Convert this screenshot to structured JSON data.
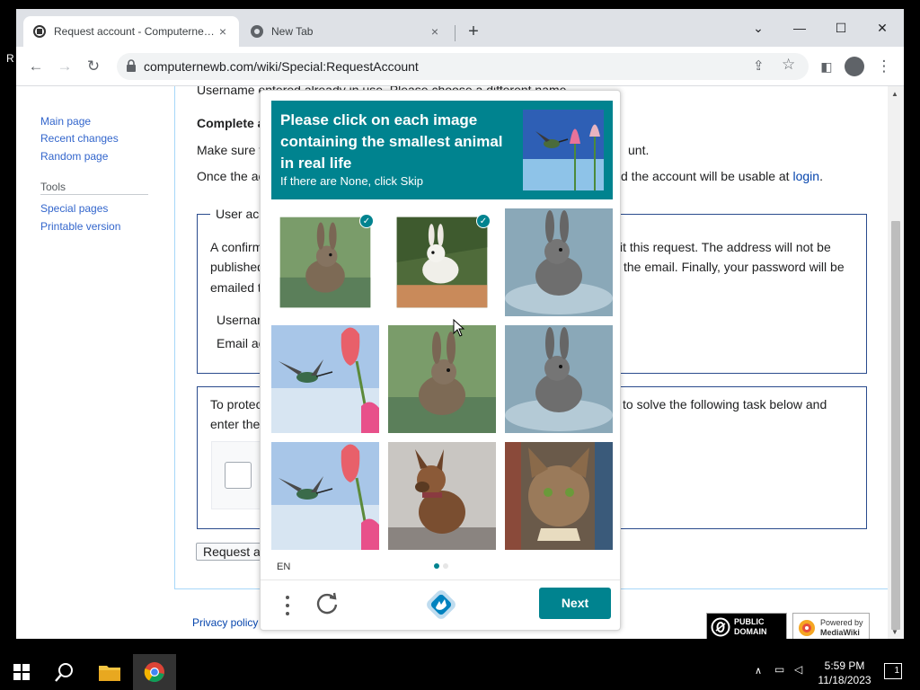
{
  "desktop": {
    "edge_letter": "R"
  },
  "browser": {
    "tabs": [
      {
        "title": "Request account - Computernewb",
        "close": "×"
      },
      {
        "title": "New Tab",
        "close": "×"
      }
    ],
    "new_tab": "+",
    "window_controls": {
      "menu": "⌄",
      "minimize": "—",
      "maximize": "☐",
      "close": "✕"
    },
    "toolbar": {
      "back": "←",
      "forward": "→",
      "reload": "↻",
      "url": "computernewb.com/wiki/Special:RequestAccount",
      "menu": "⋮"
    }
  },
  "wiki": {
    "sidebar": {
      "nav": [
        "Main page",
        "Recent changes",
        "Random page"
      ],
      "tools_heading": "Tools",
      "tools": [
        "Special pages",
        "Printable version"
      ]
    },
    "content": {
      "error_line": "Username entered already in use. Please choose a different name.",
      "complete_heading": "Complete a",
      "make_sure_left": "Make sure t",
      "make_sure_right": "unt.",
      "once_left": "Once the ac",
      "once_right": "d the account will be usable at",
      "login_link": "login",
      "login_period": ".",
      "fieldset_legend": "User ac",
      "confirm_l1_left": "A confirm",
      "confirm_l1_right": "it this request. The address will not be",
      "confirm_l2_left": "published",
      "confirm_l2_right": "the email. Finally, your password will be",
      "confirm_l3_left": "emailed t",
      "username_label": "Usernar",
      "email_label": "Email ac",
      "protect_l1_left": "To protec",
      "protect_l1_right": "to solve the following task below and",
      "protect_l2_left": "enter the",
      "request_button": "Request ac"
    },
    "footer": {
      "privacy": "Privacy policy",
      "badge_pd": "PUBLIC DOMAIN",
      "badge_mw_1": "Powered by",
      "badge_mw_2": "MediaWiki"
    }
  },
  "captcha": {
    "prompt": "Please click on each image containing the smallest animal in real life",
    "sub": "If there are None, click Skip",
    "example_icon": "hummingbird-flower-example",
    "grid": [
      {
        "subject": "rabbit",
        "selected": true
      },
      {
        "subject": "white-rabbit",
        "selected": true
      },
      {
        "subject": "rabbit",
        "selected": false
      },
      {
        "subject": "hummingbird",
        "selected": false
      },
      {
        "subject": "rabbit",
        "selected": false
      },
      {
        "subject": "rabbit",
        "selected": false
      },
      {
        "subject": "hummingbird",
        "selected": false
      },
      {
        "subject": "dog",
        "selected": false
      },
      {
        "subject": "cat",
        "selected": false
      }
    ],
    "check_glyph": "✓",
    "language": "EN",
    "next": "Next",
    "accent": "#00838f"
  },
  "taskbar": {
    "time": "5:59 PM",
    "date": "11/18/2023",
    "notifications": "1"
  }
}
